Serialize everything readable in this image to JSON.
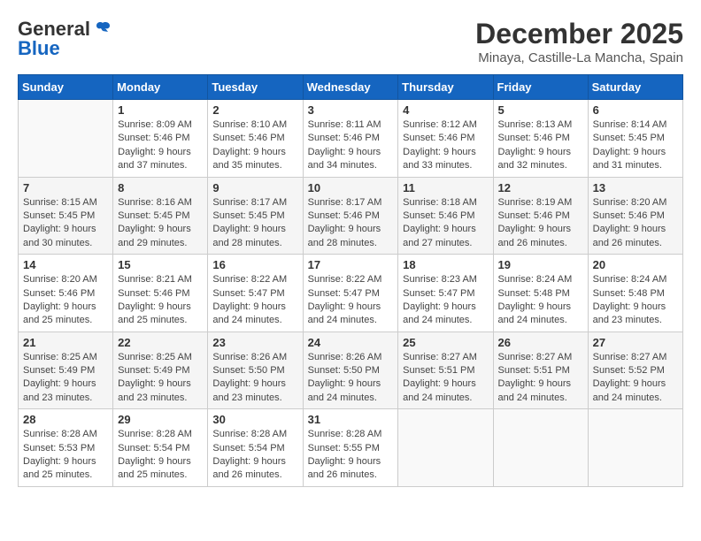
{
  "header": {
    "logo_general": "General",
    "logo_blue": "Blue",
    "month_title": "December 2025",
    "location": "Minaya, Castille-La Mancha, Spain"
  },
  "weekdays": [
    "Sunday",
    "Monday",
    "Tuesday",
    "Wednesday",
    "Thursday",
    "Friday",
    "Saturday"
  ],
  "weeks": [
    [
      {
        "day": "",
        "info": ""
      },
      {
        "day": "1",
        "info": "Sunrise: 8:09 AM\nSunset: 5:46 PM\nDaylight: 9 hours\nand 37 minutes."
      },
      {
        "day": "2",
        "info": "Sunrise: 8:10 AM\nSunset: 5:46 PM\nDaylight: 9 hours\nand 35 minutes."
      },
      {
        "day": "3",
        "info": "Sunrise: 8:11 AM\nSunset: 5:46 PM\nDaylight: 9 hours\nand 34 minutes."
      },
      {
        "day": "4",
        "info": "Sunrise: 8:12 AM\nSunset: 5:46 PM\nDaylight: 9 hours\nand 33 minutes."
      },
      {
        "day": "5",
        "info": "Sunrise: 8:13 AM\nSunset: 5:46 PM\nDaylight: 9 hours\nand 32 minutes."
      },
      {
        "day": "6",
        "info": "Sunrise: 8:14 AM\nSunset: 5:45 PM\nDaylight: 9 hours\nand 31 minutes."
      }
    ],
    [
      {
        "day": "7",
        "info": "Sunrise: 8:15 AM\nSunset: 5:45 PM\nDaylight: 9 hours\nand 30 minutes."
      },
      {
        "day": "8",
        "info": "Sunrise: 8:16 AM\nSunset: 5:45 PM\nDaylight: 9 hours\nand 29 minutes."
      },
      {
        "day": "9",
        "info": "Sunrise: 8:17 AM\nSunset: 5:45 PM\nDaylight: 9 hours\nand 28 minutes."
      },
      {
        "day": "10",
        "info": "Sunrise: 8:17 AM\nSunset: 5:46 PM\nDaylight: 9 hours\nand 28 minutes."
      },
      {
        "day": "11",
        "info": "Sunrise: 8:18 AM\nSunset: 5:46 PM\nDaylight: 9 hours\nand 27 minutes."
      },
      {
        "day": "12",
        "info": "Sunrise: 8:19 AM\nSunset: 5:46 PM\nDaylight: 9 hours\nand 26 minutes."
      },
      {
        "day": "13",
        "info": "Sunrise: 8:20 AM\nSunset: 5:46 PM\nDaylight: 9 hours\nand 26 minutes."
      }
    ],
    [
      {
        "day": "14",
        "info": "Sunrise: 8:20 AM\nSunset: 5:46 PM\nDaylight: 9 hours\nand 25 minutes."
      },
      {
        "day": "15",
        "info": "Sunrise: 8:21 AM\nSunset: 5:46 PM\nDaylight: 9 hours\nand 25 minutes."
      },
      {
        "day": "16",
        "info": "Sunrise: 8:22 AM\nSunset: 5:47 PM\nDaylight: 9 hours\nand 24 minutes."
      },
      {
        "day": "17",
        "info": "Sunrise: 8:22 AM\nSunset: 5:47 PM\nDaylight: 9 hours\nand 24 minutes."
      },
      {
        "day": "18",
        "info": "Sunrise: 8:23 AM\nSunset: 5:47 PM\nDaylight: 9 hours\nand 24 minutes."
      },
      {
        "day": "19",
        "info": "Sunrise: 8:24 AM\nSunset: 5:48 PM\nDaylight: 9 hours\nand 24 minutes."
      },
      {
        "day": "20",
        "info": "Sunrise: 8:24 AM\nSunset: 5:48 PM\nDaylight: 9 hours\nand 23 minutes."
      }
    ],
    [
      {
        "day": "21",
        "info": "Sunrise: 8:25 AM\nSunset: 5:49 PM\nDaylight: 9 hours\nand 23 minutes."
      },
      {
        "day": "22",
        "info": "Sunrise: 8:25 AM\nSunset: 5:49 PM\nDaylight: 9 hours\nand 23 minutes."
      },
      {
        "day": "23",
        "info": "Sunrise: 8:26 AM\nSunset: 5:50 PM\nDaylight: 9 hours\nand 23 minutes."
      },
      {
        "day": "24",
        "info": "Sunrise: 8:26 AM\nSunset: 5:50 PM\nDaylight: 9 hours\nand 24 minutes."
      },
      {
        "day": "25",
        "info": "Sunrise: 8:27 AM\nSunset: 5:51 PM\nDaylight: 9 hours\nand 24 minutes."
      },
      {
        "day": "26",
        "info": "Sunrise: 8:27 AM\nSunset: 5:51 PM\nDaylight: 9 hours\nand 24 minutes."
      },
      {
        "day": "27",
        "info": "Sunrise: 8:27 AM\nSunset: 5:52 PM\nDaylight: 9 hours\nand 24 minutes."
      }
    ],
    [
      {
        "day": "28",
        "info": "Sunrise: 8:28 AM\nSunset: 5:53 PM\nDaylight: 9 hours\nand 25 minutes."
      },
      {
        "day": "29",
        "info": "Sunrise: 8:28 AM\nSunset: 5:54 PM\nDaylight: 9 hours\nand 25 minutes."
      },
      {
        "day": "30",
        "info": "Sunrise: 8:28 AM\nSunset: 5:54 PM\nDaylight: 9 hours\nand 26 minutes."
      },
      {
        "day": "31",
        "info": "Sunrise: 8:28 AM\nSunset: 5:55 PM\nDaylight: 9 hours\nand 26 minutes."
      },
      {
        "day": "",
        "info": ""
      },
      {
        "day": "",
        "info": ""
      },
      {
        "day": "",
        "info": ""
      }
    ]
  ]
}
